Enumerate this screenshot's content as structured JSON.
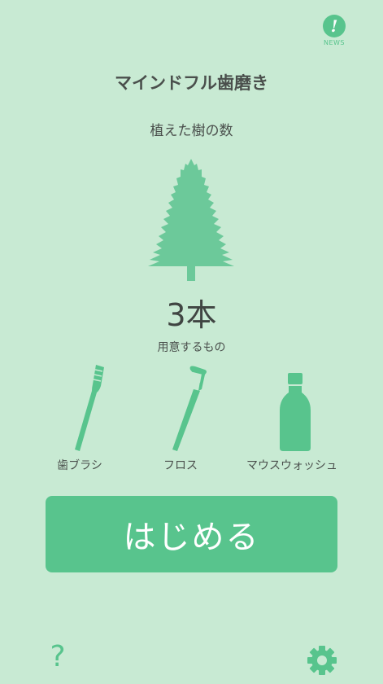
{
  "news": {
    "icon": "exclamation-icon",
    "label": "NEWS"
  },
  "header": {
    "title": "マインドフル歯磨き"
  },
  "trees": {
    "label": "植えた樹の数",
    "count": "3本"
  },
  "items": {
    "heading": "用意するもの",
    "list": [
      {
        "label": "歯ブラシ",
        "icon": "toothbrush-icon"
      },
      {
        "label": "フロス",
        "icon": "floss-icon"
      },
      {
        "label": "マウスウォッシュ",
        "icon": "mouthwash-bottle-icon"
      }
    ]
  },
  "start_button": {
    "label": "はじめる"
  },
  "footer": {
    "help_glyph": "?",
    "settings_icon": "gear-icon"
  },
  "colors": {
    "background": "#c8ead3",
    "accent": "#58c48d",
    "text": "#4a4f4c",
    "button_text": "#ffffff"
  }
}
